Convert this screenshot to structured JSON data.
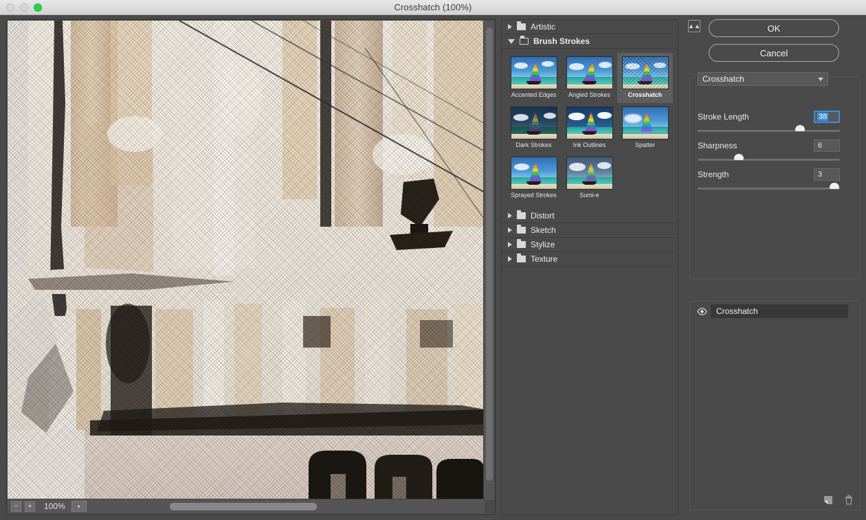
{
  "window": {
    "title": "Crosshatch (100%)",
    "traffic_lights": [
      "close-button",
      "minimize-button",
      "maximize-button"
    ]
  },
  "preview": {
    "zoom_level": "100%",
    "zoom_out_label": "−",
    "zoom_in_label": "+",
    "zoom_menu_icon": "chevron-down-icon",
    "image_description": "Crosshatch-filtered photograph of a building facade with columns, arches and overhead cables"
  },
  "filters": {
    "categories": [
      {
        "label": "Artistic",
        "expanded": false
      },
      {
        "label": "Brush Strokes",
        "expanded": true
      },
      {
        "label": "Distort",
        "expanded": false
      },
      {
        "label": "Sketch",
        "expanded": false
      },
      {
        "label": "Stylize",
        "expanded": false
      },
      {
        "label": "Texture",
        "expanded": false
      }
    ],
    "brush_strokes_items": [
      {
        "label": "Accented Edges",
        "selected": false,
        "variant": "t-accented"
      },
      {
        "label": "Angled Strokes",
        "selected": false,
        "variant": "t-angled"
      },
      {
        "label": "Crosshatch",
        "selected": true,
        "variant": "t-crosshatch"
      },
      {
        "label": "Dark Strokes",
        "selected": false,
        "variant": "t-dark"
      },
      {
        "label": "Ink Outlines",
        "selected": false,
        "variant": "t-ink"
      },
      {
        "label": "Spatter",
        "selected": false,
        "variant": "t-spatter"
      },
      {
        "label": "Sprayed Strokes",
        "selected": false,
        "variant": "t-sprayed"
      },
      {
        "label": "Sumi-e",
        "selected": false,
        "variant": "t-sumi"
      }
    ]
  },
  "controls": {
    "collapse_icon": "double-chevron-up-icon",
    "ok_label": "OK",
    "cancel_label": "Cancel",
    "selected_filter": "Crosshatch",
    "dropdown_icon": "chevron-down-icon",
    "parameters": [
      {
        "name": "Stroke Length",
        "value": "38",
        "percent": 72,
        "focused": true
      },
      {
        "name": "Sharpness",
        "value": "6",
        "percent": 29,
        "focused": false
      },
      {
        "name": "Strength",
        "value": "3",
        "percent": 96,
        "focused": false
      }
    ]
  },
  "layers": {
    "items": [
      {
        "name": "Crosshatch",
        "visible": true,
        "visibility_icon": "eye-icon"
      }
    ],
    "new_effect_layer_icon": "new-effect-layer-icon",
    "delete_layer_icon": "trash-icon"
  },
  "colors": {
    "panel_bg": "#4a4a4a",
    "titlebar_bg": "#dcdcdc",
    "accent_blue": "#3b8ee0",
    "maximize_green": "#2ad04a",
    "text_light": "#efefef",
    "selected_thumb_bg": "#5e5e5e",
    "layer_row_bg": "#383838"
  }
}
